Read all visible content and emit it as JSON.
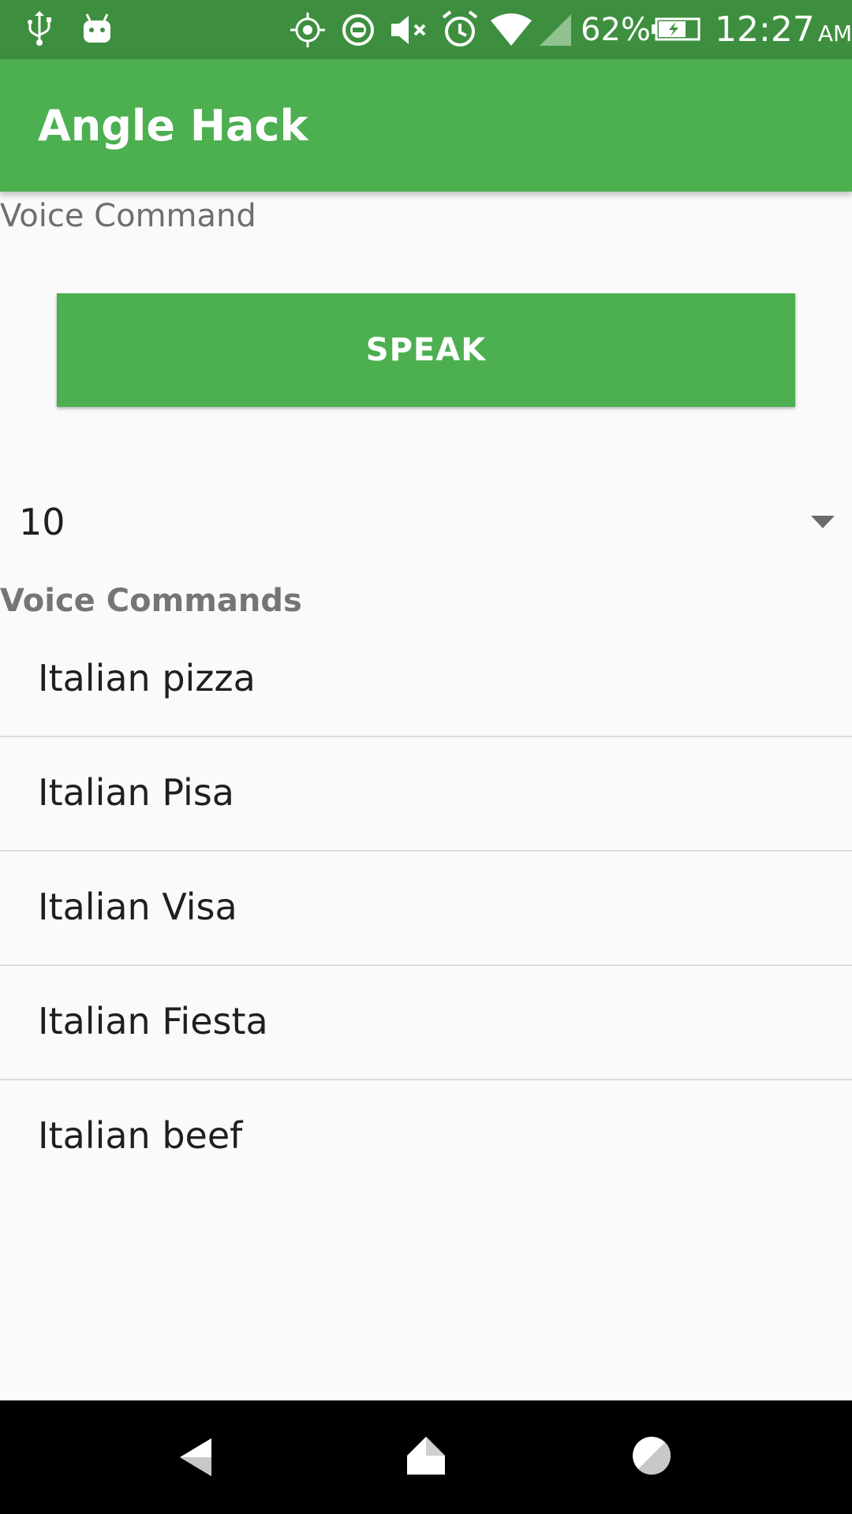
{
  "status_bar": {
    "battery_percent": "62%",
    "time": "12:27",
    "ampm": "AM",
    "icons": [
      "usb-icon",
      "android-debug-icon",
      "location-icon",
      "do-not-disturb-icon",
      "mute-icon",
      "alarm-icon",
      "wifi-icon",
      "signal-icon",
      "battery-charging-icon"
    ]
  },
  "app_bar": {
    "title": "Angle Hack",
    "color": "#4caf50"
  },
  "main": {
    "section_label": "Voice Command",
    "speak_button_label": "SPEAK",
    "spinner": {
      "selected_value": "10"
    },
    "list_header": "Voice Commands",
    "commands": [
      "Italian pizza",
      "Italian Pisa",
      "Italian Visa",
      "Italian Fiesta",
      "Italian beef"
    ]
  },
  "nav_bar": {
    "icons": [
      "back-icon",
      "home-icon",
      "recents-icon"
    ]
  }
}
